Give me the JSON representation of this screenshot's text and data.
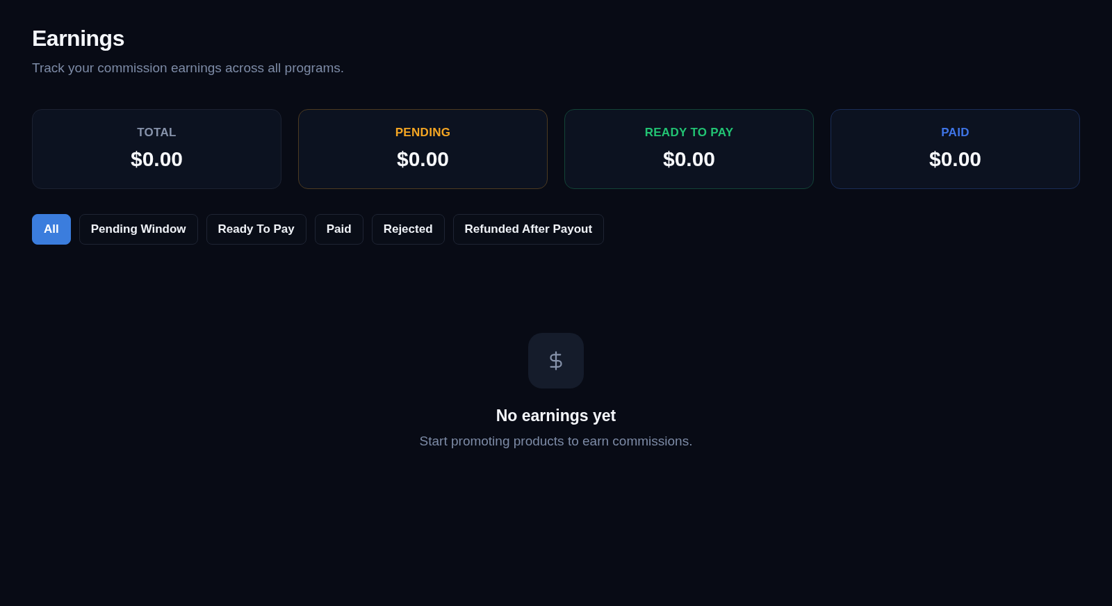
{
  "page": {
    "title": "Earnings",
    "subtitle": "Track your commission earnings across all programs."
  },
  "summary_cards": [
    {
      "label": "TOTAL",
      "value": "$0.00",
      "color": "#8793ab"
    },
    {
      "label": "PENDING",
      "value": "$0.00",
      "color": "#f5a623"
    },
    {
      "label": "READY TO PAY",
      "value": "$0.00",
      "color": "#22c373"
    },
    {
      "label": "PAID",
      "value": "$0.00",
      "color": "#3f74e6"
    }
  ],
  "filter_tabs": [
    {
      "label": "All",
      "selected": true
    },
    {
      "label": "Pending Window",
      "selected": false
    },
    {
      "label": "Ready To Pay",
      "selected": false
    },
    {
      "label": "Paid",
      "selected": false
    },
    {
      "label": "Rejected",
      "selected": false
    },
    {
      "label": "Refunded After Payout",
      "selected": false
    }
  ],
  "empty_state": {
    "title": "No earnings yet",
    "message": "Start promoting products to earn commissions."
  }
}
